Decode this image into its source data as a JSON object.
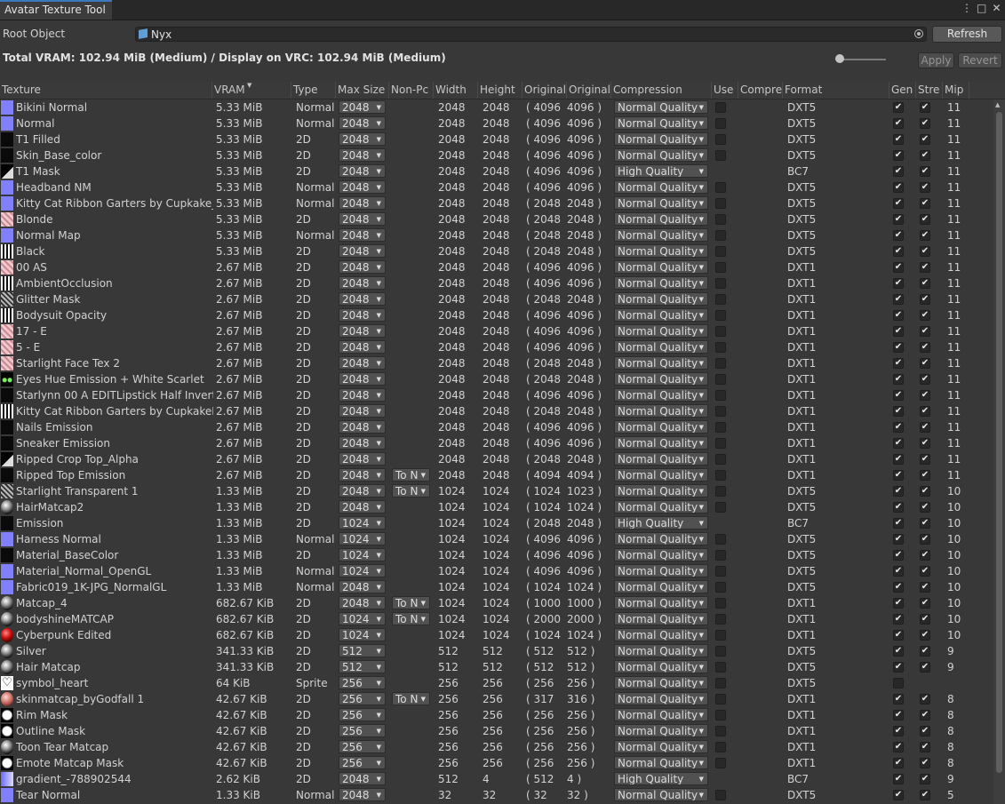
{
  "window": {
    "title": "Avatar Texture Tool"
  },
  "root": {
    "label": "Root Object",
    "value": "Nyx",
    "refresh_label": "Refresh"
  },
  "summary": {
    "text": "Total VRAM: 102.94 MiB (Medium) / Display on VRC: 102.94 MiB (Medium)"
  },
  "actions": {
    "apply_label": "Apply",
    "revert_label": "Revert"
  },
  "columns": [
    "Texture",
    "VRAM",
    "Type",
    "Max Size",
    "Non-Pc",
    "Width",
    "Height",
    "Original",
    "Original",
    "Compression",
    "Use",
    "Compre",
    "Format",
    "Gen",
    "Stre",
    "Mip"
  ],
  "colors": {
    "normal_thumb": "#8080ff",
    "accent": "#3a79bb"
  },
  "rows": [
    {
      "name": "Bikini Normal",
      "vram": "5.33 MiB",
      "type": "Normal",
      "max": "2048",
      "np": "",
      "w": "2048",
      "h": "2048",
      "ow": "( 4096",
      "oh": "4096 )",
      "comp": "Normal Quality",
      "use": false,
      "fmt": "DXT5",
      "gen": true,
      "str": true,
      "mip": "11",
      "thumb": "normal"
    },
    {
      "name": "Normal",
      "vram": "5.33 MiB",
      "type": "Normal",
      "max": "2048",
      "np": "",
      "w": "2048",
      "h": "2048",
      "ow": "( 4096",
      "oh": "4096 )",
      "comp": "Normal Quality",
      "use": false,
      "fmt": "DXT5",
      "gen": true,
      "str": true,
      "mip": "11",
      "thumb": "normal"
    },
    {
      "name": "T1 Filled",
      "vram": "5.33 MiB",
      "type": "2D",
      "max": "2048",
      "np": "",
      "w": "2048",
      "h": "2048",
      "ow": "( 4096",
      "oh": "4096 )",
      "comp": "Normal Quality",
      "use": false,
      "fmt": "DXT5",
      "gen": true,
      "str": true,
      "mip": "11",
      "thumb": "dark"
    },
    {
      "name": "Skin_Base_color",
      "vram": "5.33 MiB",
      "type": "2D",
      "max": "2048",
      "np": "",
      "w": "2048",
      "h": "2048",
      "ow": "( 4096",
      "oh": "4096 )",
      "comp": "Normal Quality",
      "use": false,
      "fmt": "DXT5",
      "gen": true,
      "str": true,
      "mip": "11",
      "thumb": "dark"
    },
    {
      "name": "T1 Mask",
      "vram": "5.33 MiB",
      "type": "2D",
      "max": "2048",
      "np": "",
      "w": "2048",
      "h": "2048",
      "ow": "( 4096",
      "oh": "4096 )",
      "comp": "High Quality",
      "use": null,
      "fmt": "BC7",
      "gen": true,
      "str": true,
      "mip": "11",
      "thumb": "mask"
    },
    {
      "name": "Headband NM",
      "vram": "5.33 MiB",
      "type": "Normal",
      "max": "2048",
      "np": "",
      "w": "2048",
      "h": "2048",
      "ow": "( 4096",
      "oh": "4096 )",
      "comp": "Normal Quality",
      "use": false,
      "fmt": "DXT5",
      "gen": true,
      "str": true,
      "mip": "11",
      "thumb": "normal"
    },
    {
      "name": "Kitty Cat Ribbon Garters by Cupkake_Cl",
      "vram": "5.33 MiB",
      "type": "Normal",
      "max": "2048",
      "np": "",
      "w": "2048",
      "h": "2048",
      "ow": "( 2048",
      "oh": "2048 )",
      "comp": "Normal Quality",
      "use": false,
      "fmt": "DXT5",
      "gen": true,
      "str": true,
      "mip": "11",
      "thumb": "normal"
    },
    {
      "name": "Blonde",
      "vram": "5.33 MiB",
      "type": "2D",
      "max": "2048",
      "np": "",
      "w": "2048",
      "h": "2048",
      "ow": "( 2048",
      "oh": "2048 )",
      "comp": "Normal Quality",
      "use": false,
      "fmt": "DXT5",
      "gen": true,
      "str": true,
      "mip": "11",
      "thumb": "pink"
    },
    {
      "name": "Normal Map",
      "vram": "5.33 MiB",
      "type": "Normal",
      "max": "2048",
      "np": "",
      "w": "2048",
      "h": "2048",
      "ow": "( 2048",
      "oh": "2048 )",
      "comp": "Normal Quality",
      "use": false,
      "fmt": "DXT5",
      "gen": true,
      "str": true,
      "mip": "11",
      "thumb": "normal"
    },
    {
      "name": "Black",
      "vram": "5.33 MiB",
      "type": "2D",
      "max": "2048",
      "np": "",
      "w": "2048",
      "h": "2048",
      "ow": "( 2048",
      "oh": "2048 )",
      "comp": "Normal Quality",
      "use": false,
      "fmt": "DXT5",
      "gen": true,
      "str": true,
      "mip": "11",
      "thumb": "stripe"
    },
    {
      "name": "00 AS",
      "vram": "2.67 MiB",
      "type": "2D",
      "max": "2048",
      "np": "",
      "w": "2048",
      "h": "2048",
      "ow": "( 4096",
      "oh": "4096 )",
      "comp": "Normal Quality",
      "use": false,
      "fmt": "DXT1",
      "gen": true,
      "str": true,
      "mip": "11",
      "thumb": "pink"
    },
    {
      "name": "AmbientOcclusion",
      "vram": "2.67 MiB",
      "type": "2D",
      "max": "2048",
      "np": "",
      "w": "2048",
      "h": "2048",
      "ow": "( 4096",
      "oh": "4096 )",
      "comp": "Normal Quality",
      "use": false,
      "fmt": "DXT1",
      "gen": true,
      "str": true,
      "mip": "11",
      "thumb": "stripe"
    },
    {
      "name": "Glitter Mask",
      "vram": "2.67 MiB",
      "type": "2D",
      "max": "2048",
      "np": "",
      "w": "2048",
      "h": "2048",
      "ow": "( 2048",
      "oh": "2048 )",
      "comp": "Normal Quality",
      "use": false,
      "fmt": "DXT1",
      "gen": true,
      "str": true,
      "mip": "11",
      "thumb": "gray"
    },
    {
      "name": "Bodysuit Opacity",
      "vram": "2.67 MiB",
      "type": "2D",
      "max": "2048",
      "np": "",
      "w": "2048",
      "h": "2048",
      "ow": "( 4096",
      "oh": "4096 )",
      "comp": "Normal Quality",
      "use": false,
      "fmt": "DXT1",
      "gen": true,
      "str": true,
      "mip": "11",
      "thumb": "stripe"
    },
    {
      "name": "17 - E",
      "vram": "2.67 MiB",
      "type": "2D",
      "max": "2048",
      "np": "",
      "w": "2048",
      "h": "2048",
      "ow": "( 4096",
      "oh": "4096 )",
      "comp": "Normal Quality",
      "use": false,
      "fmt": "DXT1",
      "gen": true,
      "str": true,
      "mip": "11",
      "thumb": "pink"
    },
    {
      "name": "5 - E",
      "vram": "2.67 MiB",
      "type": "2D",
      "max": "2048",
      "np": "",
      "w": "2048",
      "h": "2048",
      "ow": "( 4096",
      "oh": "4096 )",
      "comp": "Normal Quality",
      "use": false,
      "fmt": "DXT1",
      "gen": true,
      "str": true,
      "mip": "11",
      "thumb": "pink"
    },
    {
      "name": "Starlight Face Tex 2",
      "vram": "2.67 MiB",
      "type": "2D",
      "max": "2048",
      "np": "",
      "w": "2048",
      "h": "2048",
      "ow": "( 2048",
      "oh": "2048 )",
      "comp": "Normal Quality",
      "use": false,
      "fmt": "DXT1",
      "gen": true,
      "str": true,
      "mip": "11",
      "thumb": "pink"
    },
    {
      "name": "Eyes Hue Emission + White Scarlet",
      "vram": "2.67 MiB",
      "type": "2D",
      "max": "2048",
      "np": "",
      "w": "2048",
      "h": "2048",
      "ow": "( 2048",
      "oh": "2048 )",
      "comp": "Normal Quality",
      "use": false,
      "fmt": "DXT1",
      "gen": true,
      "str": true,
      "mip": "11",
      "thumb": "eyes"
    },
    {
      "name": "Starlynn 00 A EDITLipstick Half Inverte",
      "vram": "2.67 MiB",
      "type": "2D",
      "max": "2048",
      "np": "",
      "w": "2048",
      "h": "2048",
      "ow": "( 4096",
      "oh": "4096 )",
      "comp": "Normal Quality",
      "use": false,
      "fmt": "DXT1",
      "gen": true,
      "str": true,
      "mip": "11",
      "thumb": "dark"
    },
    {
      "name": "Kitty Cat Ribbon Garters by CupkakeMa",
      "vram": "2.67 MiB",
      "type": "2D",
      "max": "2048",
      "np": "",
      "w": "2048",
      "h": "2048",
      "ow": "( 2048",
      "oh": "2048 )",
      "comp": "Normal Quality",
      "use": false,
      "fmt": "DXT1",
      "gen": true,
      "str": true,
      "mip": "11",
      "thumb": "stripe"
    },
    {
      "name": "Nails Emission",
      "vram": "2.67 MiB",
      "type": "2D",
      "max": "2048",
      "np": "",
      "w": "2048",
      "h": "2048",
      "ow": "( 4096",
      "oh": "4096 )",
      "comp": "Normal Quality",
      "use": false,
      "fmt": "DXT1",
      "gen": true,
      "str": true,
      "mip": "11",
      "thumb": "dark"
    },
    {
      "name": "Sneaker Emission",
      "vram": "2.67 MiB",
      "type": "2D",
      "max": "2048",
      "np": "",
      "w": "2048",
      "h": "2048",
      "ow": "( 4096",
      "oh": "4096 )",
      "comp": "Normal Quality",
      "use": false,
      "fmt": "DXT1",
      "gen": true,
      "str": true,
      "mip": "11",
      "thumb": "dark"
    },
    {
      "name": "Ripped Crop Top_Alpha",
      "vram": "2.67 MiB",
      "type": "2D",
      "max": "2048",
      "np": "",
      "w": "2048",
      "h": "2048",
      "ow": "( 2048",
      "oh": "2048 )",
      "comp": "Normal Quality",
      "use": false,
      "fmt": "DXT1",
      "gen": true,
      "str": true,
      "mip": "11",
      "thumb": "mask"
    },
    {
      "name": "Ripped Top Emission",
      "vram": "2.67 MiB",
      "type": "2D",
      "max": "2048",
      "np": "To N",
      "w": "2048",
      "h": "2048",
      "ow": "( 4094",
      "oh": "4094 )",
      "comp": "Normal Quality",
      "use": false,
      "fmt": "DXT1",
      "gen": true,
      "str": true,
      "mip": "11",
      "thumb": "dark"
    },
    {
      "name": "Starlight Transparent 1",
      "vram": "1.33 MiB",
      "type": "2D",
      "max": "2048",
      "np": "To N",
      "w": "1024",
      "h": "1024",
      "ow": "( 1024",
      "oh": "1023 )",
      "comp": "Normal Quality",
      "use": false,
      "fmt": "DXT5",
      "gen": true,
      "str": true,
      "mip": "10",
      "thumb": "gray"
    },
    {
      "name": "HairMatcap2",
      "vram": "1.33 MiB",
      "type": "2D",
      "max": "2048",
      "np": "",
      "w": "1024",
      "h": "1024",
      "ow": "( 1024",
      "oh": "1024 )",
      "comp": "Normal Quality",
      "use": false,
      "fmt": "DXT5",
      "gen": true,
      "str": true,
      "mip": "10",
      "thumb": "sphere"
    },
    {
      "name": "Emission",
      "vram": "1.33 MiB",
      "type": "2D",
      "max": "1024",
      "np": "",
      "w": "1024",
      "h": "1024",
      "ow": "( 2048",
      "oh": "2048 )",
      "comp": "High Quality",
      "use": null,
      "fmt": "BC7",
      "gen": true,
      "str": true,
      "mip": "10",
      "thumb": "dark"
    },
    {
      "name": "Harness Normal",
      "vram": "1.33 MiB",
      "type": "Normal",
      "max": "1024",
      "np": "",
      "w": "1024",
      "h": "1024",
      "ow": "( 4096",
      "oh": "4096 )",
      "comp": "Normal Quality",
      "use": false,
      "fmt": "DXT5",
      "gen": true,
      "str": true,
      "mip": "10",
      "thumb": "normal"
    },
    {
      "name": "Material_BaseColor",
      "vram": "1.33 MiB",
      "type": "2D",
      "max": "1024",
      "np": "",
      "w": "1024",
      "h": "1024",
      "ow": "( 4096",
      "oh": "4096 )",
      "comp": "Normal Quality",
      "use": false,
      "fmt": "DXT5",
      "gen": true,
      "str": true,
      "mip": "10",
      "thumb": "dark"
    },
    {
      "name": "Material_Normal_OpenGL",
      "vram": "1.33 MiB",
      "type": "Normal",
      "max": "1024",
      "np": "",
      "w": "1024",
      "h": "1024",
      "ow": "( 4096",
      "oh": "4096 )",
      "comp": "Normal Quality",
      "use": false,
      "fmt": "DXT5",
      "gen": true,
      "str": true,
      "mip": "10",
      "thumb": "normal"
    },
    {
      "name": "Fabric019_1K-JPG_NormalGL",
      "vram": "1.33 MiB",
      "type": "Normal",
      "max": "2048",
      "np": "",
      "w": "1024",
      "h": "1024",
      "ow": "( 1024",
      "oh": "1024 )",
      "comp": "Normal Quality",
      "use": false,
      "fmt": "DXT5",
      "gen": true,
      "str": true,
      "mip": "10",
      "thumb": "normal"
    },
    {
      "name": "Matcap_4",
      "vram": "682.67 KiB",
      "type": "2D",
      "max": "2048",
      "np": "To N",
      "w": "1024",
      "h": "1024",
      "ow": "( 1000",
      "oh": "1000 )",
      "comp": "Normal Quality",
      "use": false,
      "fmt": "DXT1",
      "gen": true,
      "str": true,
      "mip": "10",
      "thumb": "sphere"
    },
    {
      "name": "bodyshineMATCAP",
      "vram": "682.67 KiB",
      "type": "2D",
      "max": "1024",
      "np": "To N",
      "w": "1024",
      "h": "1024",
      "ow": "( 2000",
      "oh": "2000 )",
      "comp": "Normal Quality",
      "use": false,
      "fmt": "DXT1",
      "gen": true,
      "str": true,
      "mip": "10",
      "thumb": "sphere"
    },
    {
      "name": "Cyberpunk Edited",
      "vram": "682.67 KiB",
      "type": "2D",
      "max": "1024",
      "np": "",
      "w": "1024",
      "h": "1024",
      "ow": "( 1024",
      "oh": "1024 )",
      "comp": "Normal Quality",
      "use": false,
      "fmt": "DXT1",
      "gen": true,
      "str": true,
      "mip": "10",
      "thumb": "red"
    },
    {
      "name": "Silver",
      "vram": "341.33 KiB",
      "type": "2D",
      "max": "512",
      "np": "",
      "w": "512",
      "h": "512",
      "ow": "( 512",
      "oh": "512 )",
      "comp": "Normal Quality",
      "use": false,
      "fmt": "DXT5",
      "gen": true,
      "str": true,
      "mip": "9",
      "thumb": "sphere"
    },
    {
      "name": "Hair Matcap",
      "vram": "341.33 KiB",
      "type": "2D",
      "max": "512",
      "np": "",
      "w": "512",
      "h": "512",
      "ow": "( 512",
      "oh": "512 )",
      "comp": "Normal Quality",
      "use": false,
      "fmt": "DXT5",
      "gen": true,
      "str": true,
      "mip": "9",
      "thumb": "sphere"
    },
    {
      "name": "symbol_heart",
      "vram": "64 KiB",
      "type": "Sprite",
      "max": "256",
      "np": "",
      "w": "256",
      "h": "256",
      "ow": "( 256",
      "oh": "256 )",
      "comp": "Normal Quality",
      "use": false,
      "fmt": "DXT5",
      "gen": false,
      "str": null,
      "mip": "",
      "thumb": "heart"
    },
    {
      "name": "skinmatcap_byGodfall 1",
      "vram": "42.67 KiB",
      "type": "2D",
      "max": "256",
      "np": "To N",
      "w": "256",
      "h": "256",
      "ow": "( 317",
      "oh": "316 )",
      "comp": "Normal Quality",
      "use": false,
      "fmt": "DXT1",
      "gen": true,
      "str": true,
      "mip": "8",
      "thumb": "skin"
    },
    {
      "name": "Rim Mask",
      "vram": "42.67 KiB",
      "type": "2D",
      "max": "256",
      "np": "",
      "w": "256",
      "h": "256",
      "ow": "( 256",
      "oh": "256 )",
      "comp": "Normal Quality",
      "use": false,
      "fmt": "DXT1",
      "gen": true,
      "str": true,
      "mip": "8",
      "thumb": "rim"
    },
    {
      "name": "Outline Mask",
      "vram": "42.67 KiB",
      "type": "2D",
      "max": "256",
      "np": "",
      "w": "256",
      "h": "256",
      "ow": "( 256",
      "oh": "256 )",
      "comp": "Normal Quality",
      "use": false,
      "fmt": "DXT1",
      "gen": true,
      "str": true,
      "mip": "8",
      "thumb": "rim"
    },
    {
      "name": "Toon Tear Matcap",
      "vram": "42.67 KiB",
      "type": "2D",
      "max": "256",
      "np": "",
      "w": "256",
      "h": "256",
      "ow": "( 256",
      "oh": "256 )",
      "comp": "Normal Quality",
      "use": false,
      "fmt": "DXT1",
      "gen": true,
      "str": true,
      "mip": "8",
      "thumb": "sphere"
    },
    {
      "name": "Emote Matcap Mask",
      "vram": "42.67 KiB",
      "type": "2D",
      "max": "256",
      "np": "",
      "w": "256",
      "h": "256",
      "ow": "( 256",
      "oh": "256 )",
      "comp": "Normal Quality",
      "use": false,
      "fmt": "DXT1",
      "gen": true,
      "str": true,
      "mip": "8",
      "thumb": "rim"
    },
    {
      "name": "gradient_-788902544",
      "vram": "2.62 KiB",
      "type": "2D",
      "max": "2048",
      "np": "",
      "w": "512",
      "h": "4",
      "ow": "( 512",
      "oh": "4 )",
      "comp": "High Quality",
      "use": null,
      "fmt": "BC7",
      "gen": true,
      "str": true,
      "mip": "9",
      "thumb": "grad"
    },
    {
      "name": "Tear Normal",
      "vram": "1.33 KiB",
      "type": "Normal",
      "max": "2048",
      "np": "",
      "w": "32",
      "h": "32",
      "ow": "( 32",
      "oh": "32 )",
      "comp": "Normal Quality",
      "use": false,
      "fmt": "DXT5",
      "gen": true,
      "str": true,
      "mip": "5",
      "thumb": "normal"
    }
  ]
}
